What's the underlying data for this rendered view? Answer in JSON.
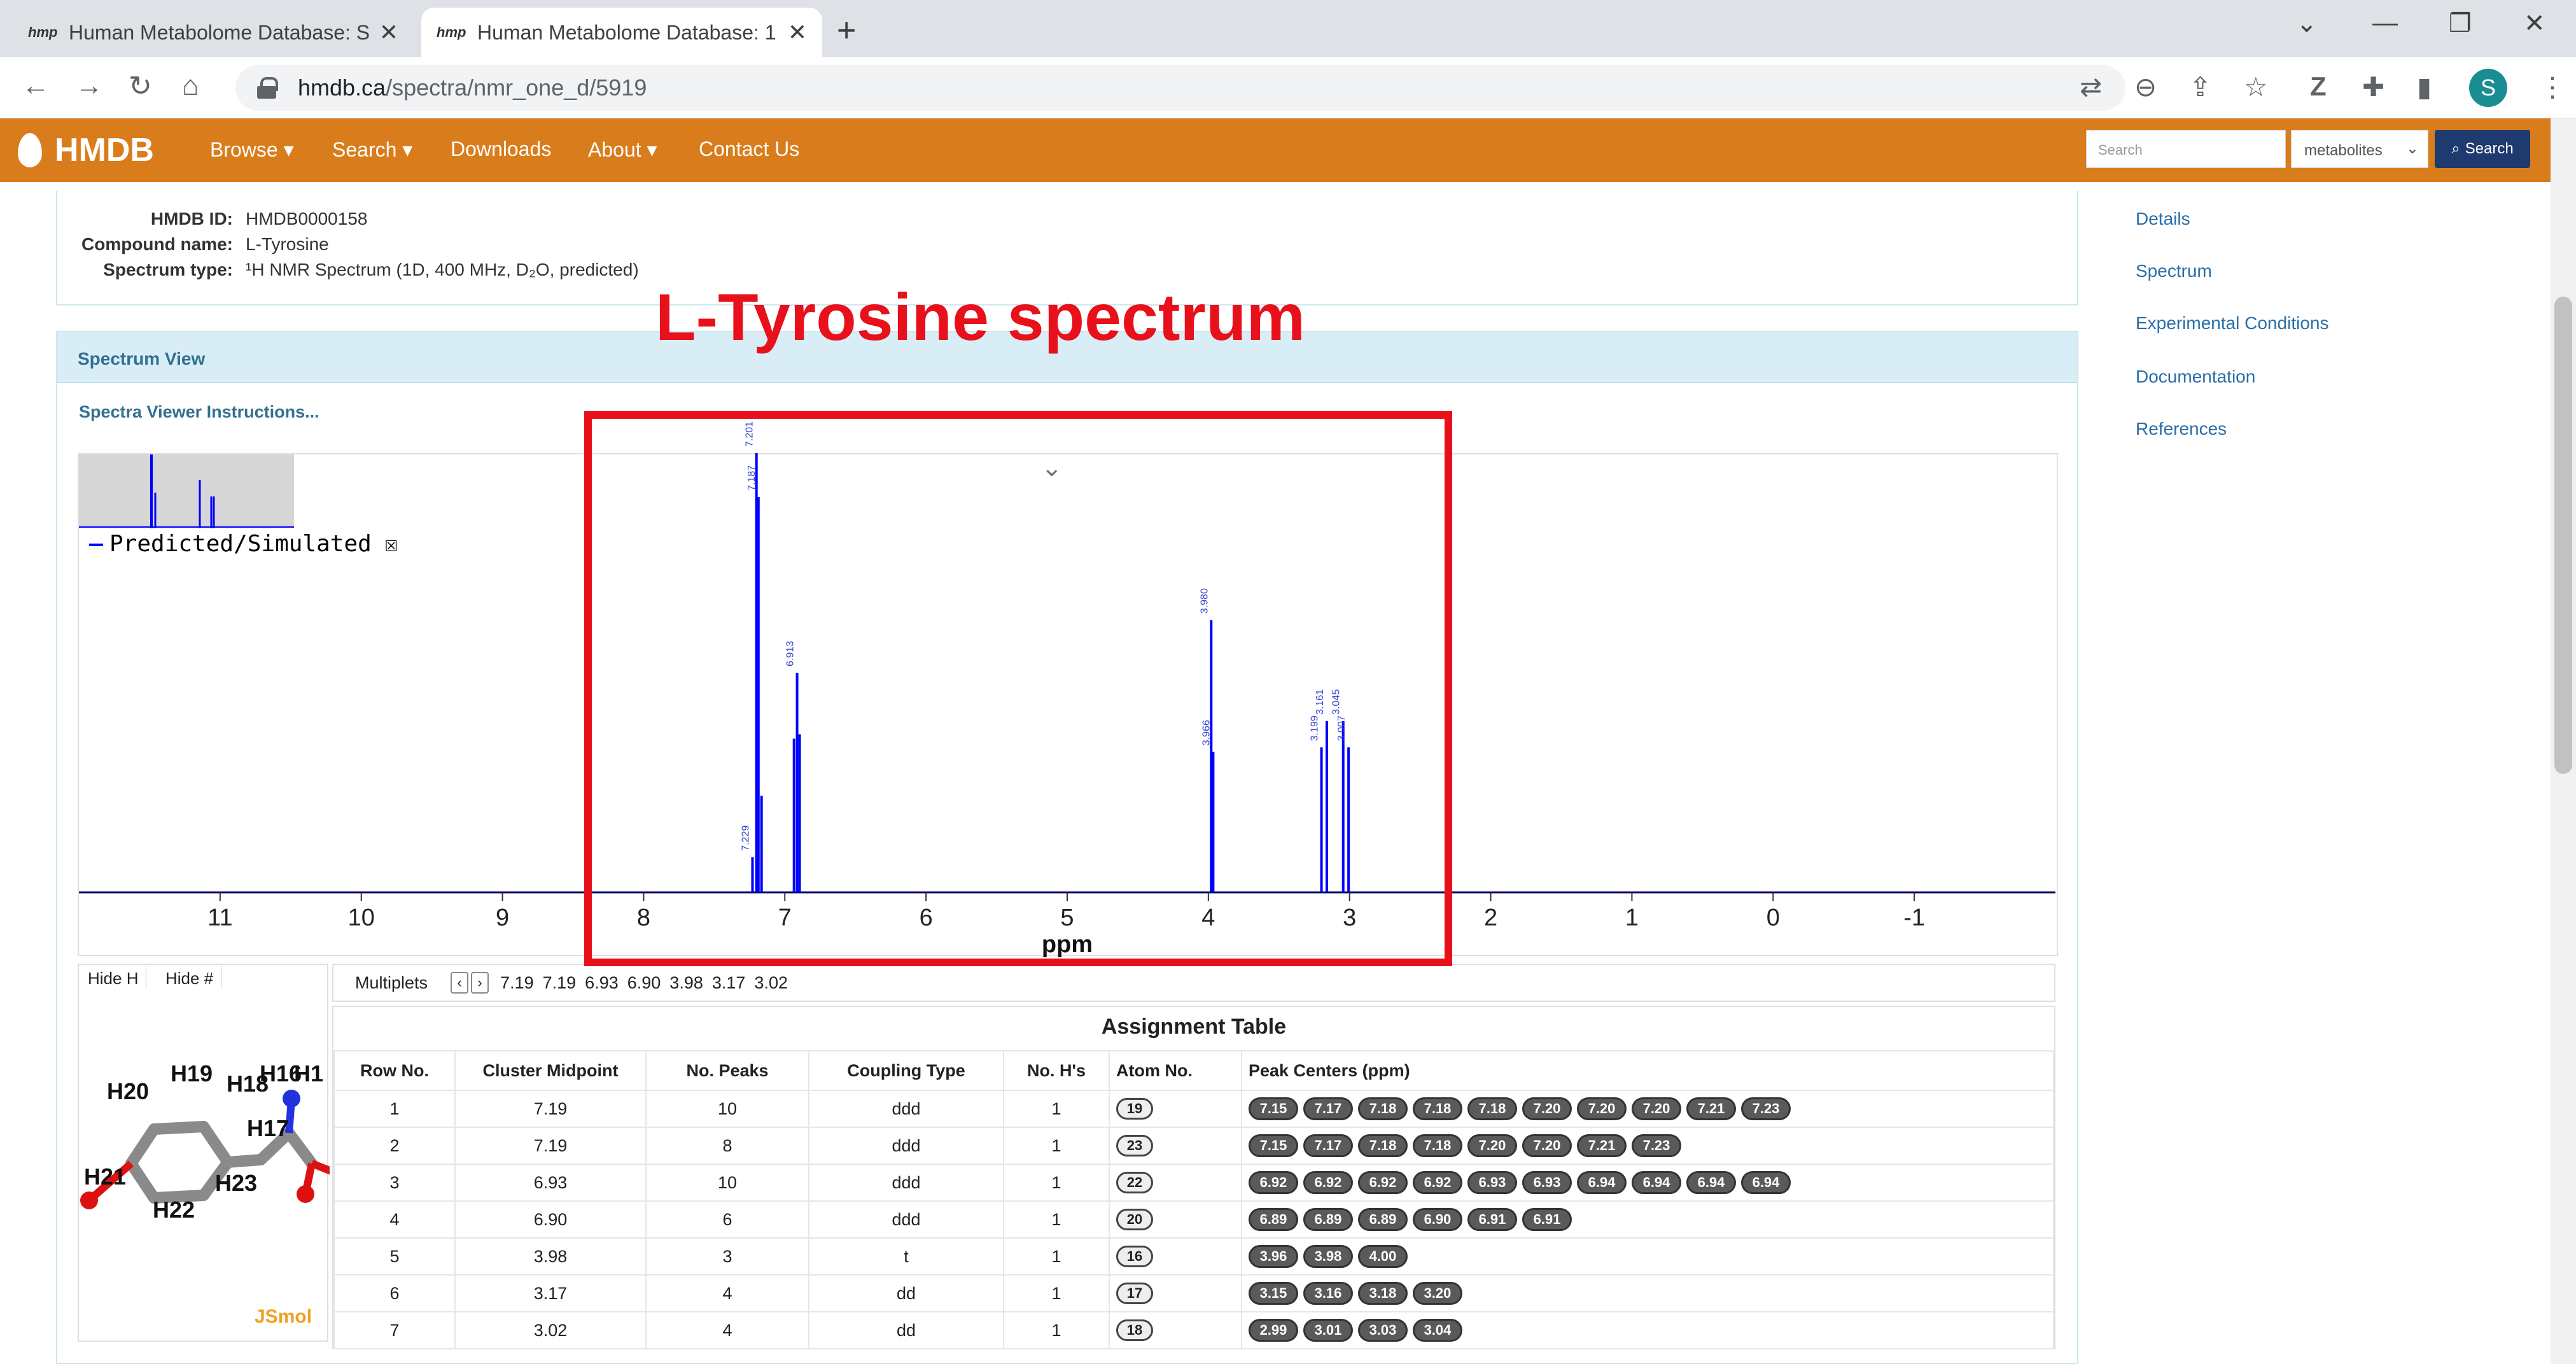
{
  "browser": {
    "tabs": [
      {
        "favicon": "hmp",
        "title": "Human Metabolome Database: S",
        "active": false
      },
      {
        "favicon": "hmp",
        "title": "Human Metabolome Database: 1",
        "active": true
      }
    ],
    "url_host": "hmdb.ca",
    "url_path": "/spectra/nmr_one_d/5919",
    "avatar_letter": "S"
  },
  "hmdb_nav": {
    "logo": "HMDB",
    "links": [
      "Browse ▾",
      "Search ▾",
      "Downloads",
      "About ▾",
      "Contact Us"
    ],
    "search_placeholder": "Search",
    "select_value": "metabolites",
    "search_button": "Search"
  },
  "info": {
    "hmdb_id_label": "HMDB ID:",
    "hmdb_id": "HMDB0000158",
    "compound_label": "Compound name:",
    "compound": "L-Tyrosine",
    "spectrum_type_label": "Spectrum type:",
    "spectrum_type": "¹H NMR Spectrum (1D, 400 MHz, D₂O, predicted)"
  },
  "annotation": {
    "title": "L-Tyrosine spectrum",
    "color": "#e8101a"
  },
  "spectrum_view": {
    "header": "Spectrum View",
    "instructions": "Spectra Viewer Instructions...",
    "legend": "Predicted/Simulated",
    "legend_close": "☒",
    "axis_label": "ppm",
    "ticks": [
      "11",
      "10",
      "9",
      "8",
      "7",
      "6",
      "5",
      "4",
      "3",
      "2",
      "1",
      "0",
      "-1"
    ]
  },
  "chart_data": {
    "type": "line",
    "xlabel": "ppm",
    "xlim": [
      12,
      -2
    ],
    "x_reversed": true,
    "series": [
      {
        "name": "Predicted/Simulated",
        "color": "#0000ff",
        "peaks": [
          {
            "x": 7.229,
            "y": 0.08,
            "label": "7.229"
          },
          {
            "x": 7.201,
            "y": 1.0,
            "label": "7.201"
          },
          {
            "x": 7.187,
            "y": 0.9,
            "label": "7.187"
          },
          {
            "x": 7.165,
            "y": 0.22,
            "label": ""
          },
          {
            "x": 6.935,
            "y": 0.35,
            "label": ""
          },
          {
            "x": 6.913,
            "y": 0.5,
            "label": "6.913"
          },
          {
            "x": 6.895,
            "y": 0.36,
            "label": ""
          },
          {
            "x": 3.98,
            "y": 0.62,
            "label": "3.980"
          },
          {
            "x": 3.966,
            "y": 0.32,
            "label": "3.966"
          },
          {
            "x": 3.199,
            "y": 0.33,
            "label": "3.199"
          },
          {
            "x": 3.161,
            "y": 0.39,
            "label": "3.161"
          },
          {
            "x": 3.045,
            "y": 0.39,
            "label": "3.045"
          },
          {
            "x": 3.007,
            "y": 0.33,
            "label": "3.007"
          }
        ]
      }
    ]
  },
  "molecule": {
    "hide_h": "Hide H",
    "hide_num": "Hide #",
    "jsmol": "JSmol",
    "atoms": [
      "H20",
      "H19",
      "H18",
      "H16",
      "H1",
      "H17",
      "H21",
      "H23",
      "H22"
    ]
  },
  "multiplets": {
    "label": "Multiplets",
    "values": [
      "7.19",
      "7.19",
      "6.93",
      "6.90",
      "3.98",
      "3.17",
      "3.02"
    ]
  },
  "assignment_table": {
    "title": "Assignment Table",
    "headers": [
      "Row No.",
      "Cluster Midpoint",
      "No. Peaks",
      "Coupling Type",
      "No. H's",
      "Atom No.",
      "Peak Centers (ppm)"
    ],
    "rows": [
      {
        "row": "1",
        "mid": "7.19",
        "peaks": "10",
        "coupling": "ddd",
        "nh": "1",
        "atom": "19",
        "centers": [
          "7.15",
          "7.17",
          "7.18",
          "7.18",
          "7.18",
          "7.20",
          "7.20",
          "7.20",
          "7.21",
          "7.23"
        ]
      },
      {
        "row": "2",
        "mid": "7.19",
        "peaks": "8",
        "coupling": "ddd",
        "nh": "1",
        "atom": "23",
        "centers": [
          "7.15",
          "7.17",
          "7.18",
          "7.18",
          "7.20",
          "7.20",
          "7.21",
          "7.23"
        ]
      },
      {
        "row": "3",
        "mid": "6.93",
        "peaks": "10",
        "coupling": "ddd",
        "nh": "1",
        "atom": "22",
        "centers": [
          "6.92",
          "6.92",
          "6.92",
          "6.92",
          "6.93",
          "6.93",
          "6.94",
          "6.94",
          "6.94",
          "6.94"
        ]
      },
      {
        "row": "4",
        "mid": "6.90",
        "peaks": "6",
        "coupling": "ddd",
        "nh": "1",
        "atom": "20",
        "centers": [
          "6.89",
          "6.89",
          "6.89",
          "6.90",
          "6.91",
          "6.91"
        ]
      },
      {
        "row": "5",
        "mid": "3.98",
        "peaks": "3",
        "coupling": "t",
        "nh": "1",
        "atom": "16",
        "centers": [
          "3.96",
          "3.98",
          "4.00"
        ]
      },
      {
        "row": "6",
        "mid": "3.17",
        "peaks": "4",
        "coupling": "dd",
        "nh": "1",
        "atom": "17",
        "centers": [
          "3.15",
          "3.16",
          "3.18",
          "3.20"
        ]
      },
      {
        "row": "7",
        "mid": "3.02",
        "peaks": "4",
        "coupling": "dd",
        "nh": "1",
        "atom": "18",
        "centers": [
          "2.99",
          "3.01",
          "3.03",
          "3.04"
        ]
      }
    ]
  },
  "side_nav": [
    "Details",
    "Spectrum",
    "Experimental Conditions",
    "Documentation",
    "References"
  ]
}
